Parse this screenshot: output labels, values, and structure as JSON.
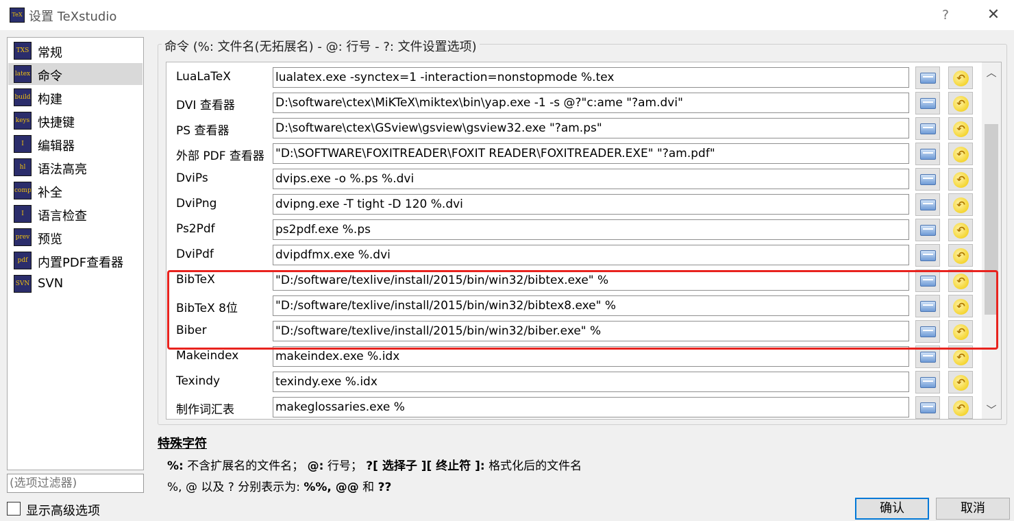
{
  "window": {
    "title": "设置 TeXstudio",
    "help_symbol": "?",
    "close_symbol": "✕",
    "app_icon_text": "TeX"
  },
  "nav": {
    "items": [
      {
        "label": "常规",
        "icon": "TXS"
      },
      {
        "label": "命令",
        "icon": "latex"
      },
      {
        "label": "构建",
        "icon": "build"
      },
      {
        "label": "快捷键",
        "icon": "keys"
      },
      {
        "label": "编辑器",
        "icon": "I"
      },
      {
        "label": "语法高亮",
        "icon": "hl"
      },
      {
        "label": "补全",
        "icon": "comp"
      },
      {
        "label": "语言检查",
        "icon": "I"
      },
      {
        "label": "预览",
        "icon": "prev"
      },
      {
        "label": "内置PDF查看器",
        "icon": "pdf"
      },
      {
        "label": "SVN",
        "icon": "SVN"
      }
    ],
    "selected_index": 1,
    "filter_placeholder": "(选项过滤器)",
    "advanced_label": "显示高级选项",
    "advanced_checked": false
  },
  "group_title": "命令 (%: 文件名(无拓展名) - @: 行号 - ?: 文件设置选项)",
  "commands": [
    {
      "label": "LuaLaTeX",
      "value": "lualatex.exe -synctex=1 -interaction=nonstopmode %.tex"
    },
    {
      "label": "DVI 查看器",
      "value": "D:\\software\\ctex\\MiKTeX\\miktex\\bin\\yap.exe -1 -s @?\"c:ame \"?am.dvi\""
    },
    {
      "label": "PS 查看器",
      "value": "D:\\software\\ctex\\GSview\\gsview\\gsview32.exe \"?am.ps\""
    },
    {
      "label": "外部 PDF 查看器",
      "value": "\"D:\\SOFTWARE\\FOXITREADER\\FOXIT READER\\FOXITREADER.EXE\" \"?am.pdf\""
    },
    {
      "label": "DviPs",
      "value": "dvips.exe -o %.ps %.dvi"
    },
    {
      "label": "DviPng",
      "value": "dvipng.exe -T tight -D 120 %.dvi"
    },
    {
      "label": "Ps2Pdf",
      "value": "ps2pdf.exe %.ps"
    },
    {
      "label": "DviPdf",
      "value": "dvipdfmx.exe %.dvi"
    },
    {
      "label": "BibTeX",
      "value": "\"D:/software/texlive/install/2015/bin/win32/bibtex.exe\" %"
    },
    {
      "label": "BibTeX 8位",
      "value": "\"D:/software/texlive/install/2015/bin/win32/bibtex8.exe\" %"
    },
    {
      "label": "Biber",
      "value": "\"D:/software/texlive/install/2015/bin/win32/biber.exe\" %"
    },
    {
      "label": "Makeindex",
      "value": "makeindex.exe %.idx"
    },
    {
      "label": "Texindy",
      "value": "texindy.exe %.idx"
    },
    {
      "label": "制作词汇表",
      "value": "makeglossaries.exe %"
    }
  ],
  "row_reset_symbol": "↶",
  "scrollbar": {
    "up": "︿",
    "down": "﹀"
  },
  "special": {
    "title": "特殊字符",
    "line1": [
      {
        "text": "%:",
        "bold": true
      },
      {
        "text": " 不含扩展名的文件名； ",
        "bold": false
      },
      {
        "text": "@:",
        "bold": true
      },
      {
        "text": " 行号； ",
        "bold": false
      },
      {
        "text": "?[ 选择子 ][ 终止符 ]:",
        "bold": true
      },
      {
        "text": " 格式化后的文件名",
        "bold": false
      }
    ],
    "line2": [
      {
        "text": "%, @ 以及 ? 分别表示为: ",
        "bold": false
      },
      {
        "text": "%%, @@",
        "bold": true
      },
      {
        "text": " 和 ",
        "bold": false
      },
      {
        "text": "??",
        "bold": true
      }
    ]
  },
  "buttons": {
    "ok": "确认",
    "cancel": "取消"
  },
  "colors": {
    "highlight": "#e8231e",
    "default_button_border": "#0078d7"
  }
}
